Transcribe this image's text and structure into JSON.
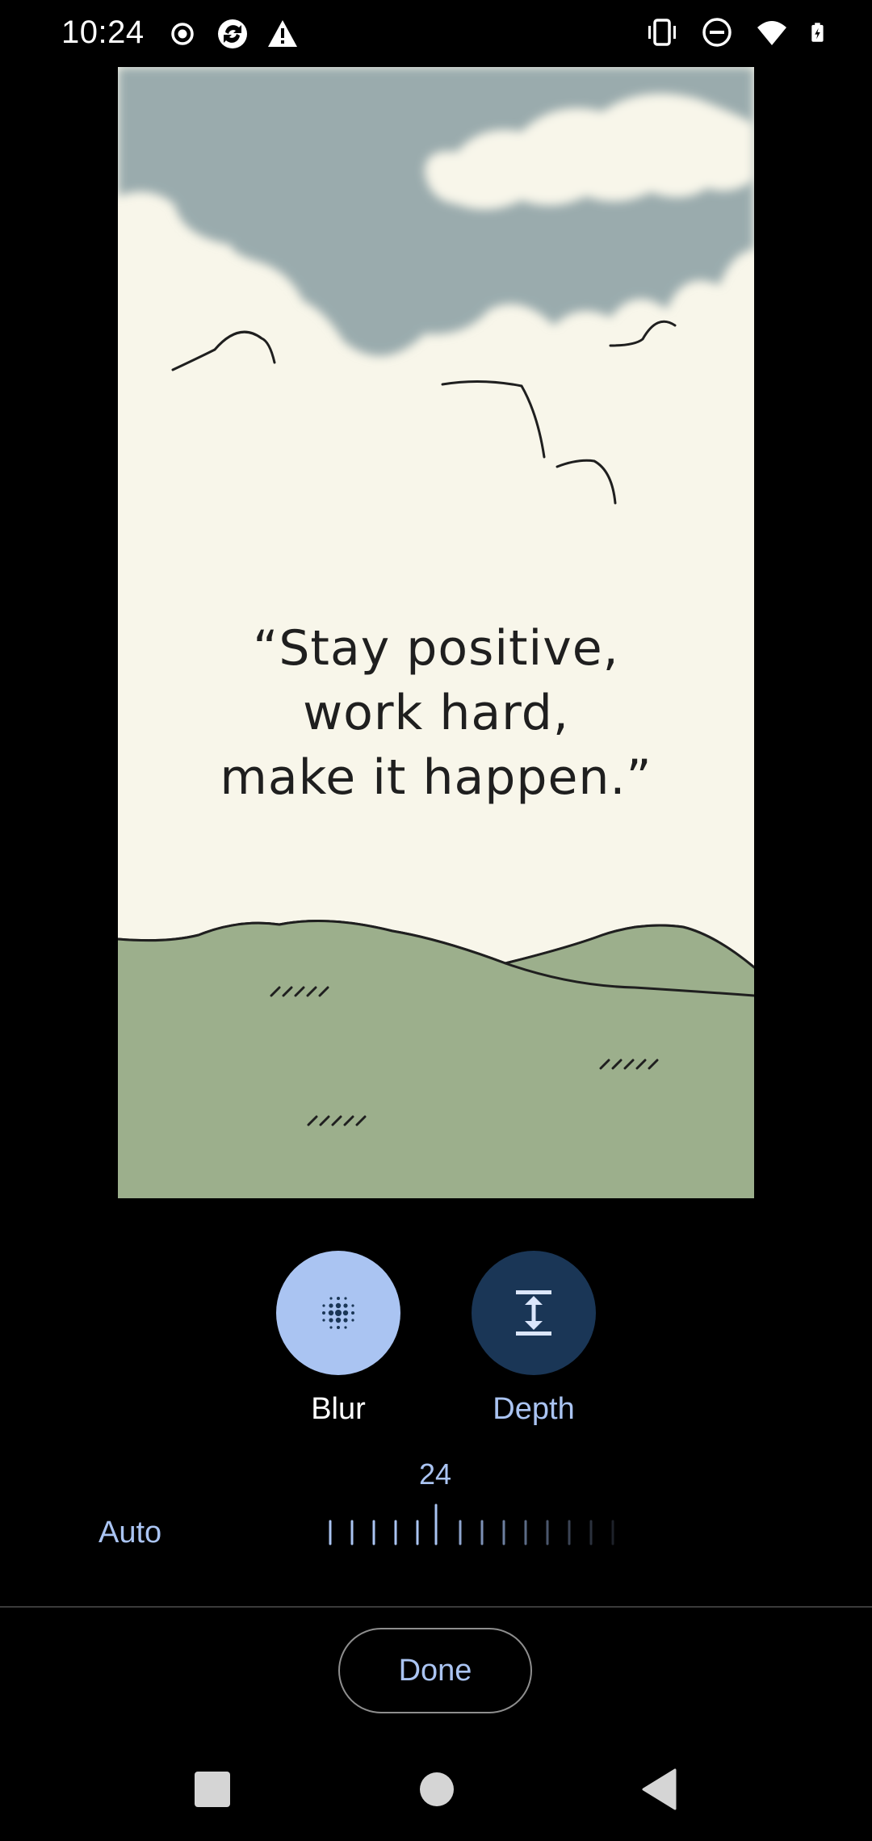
{
  "status_bar": {
    "time": "10:24",
    "left_icons": [
      "record-icon",
      "sync-icon",
      "warning-icon"
    ],
    "right_icons": [
      "vibrate-icon",
      "do-not-disturb-icon",
      "wifi-icon",
      "battery-charging-icon"
    ]
  },
  "preview": {
    "quote_lines": [
      "“Stay positive,",
      "work hard,",
      "make it happen.”"
    ],
    "colors": {
      "sky": "#9aabad",
      "cloud": "#f8f6ea",
      "hills": "#9caf8c",
      "ink": "#1f1f1f"
    }
  },
  "effects": [
    {
      "label": "Blur",
      "icon": "blur-icon",
      "selected": true
    },
    {
      "label": "Depth",
      "icon": "depth-icon",
      "selected": false
    }
  ],
  "slider": {
    "value": "24",
    "auto_label": "Auto"
  },
  "done_label": "Done",
  "nav_bar": [
    "recents-button",
    "home-button",
    "back-button"
  ],
  "colors": {
    "accent": "#aac4f2",
    "accent_dark": "#1a3656",
    "background": "#000000"
  }
}
